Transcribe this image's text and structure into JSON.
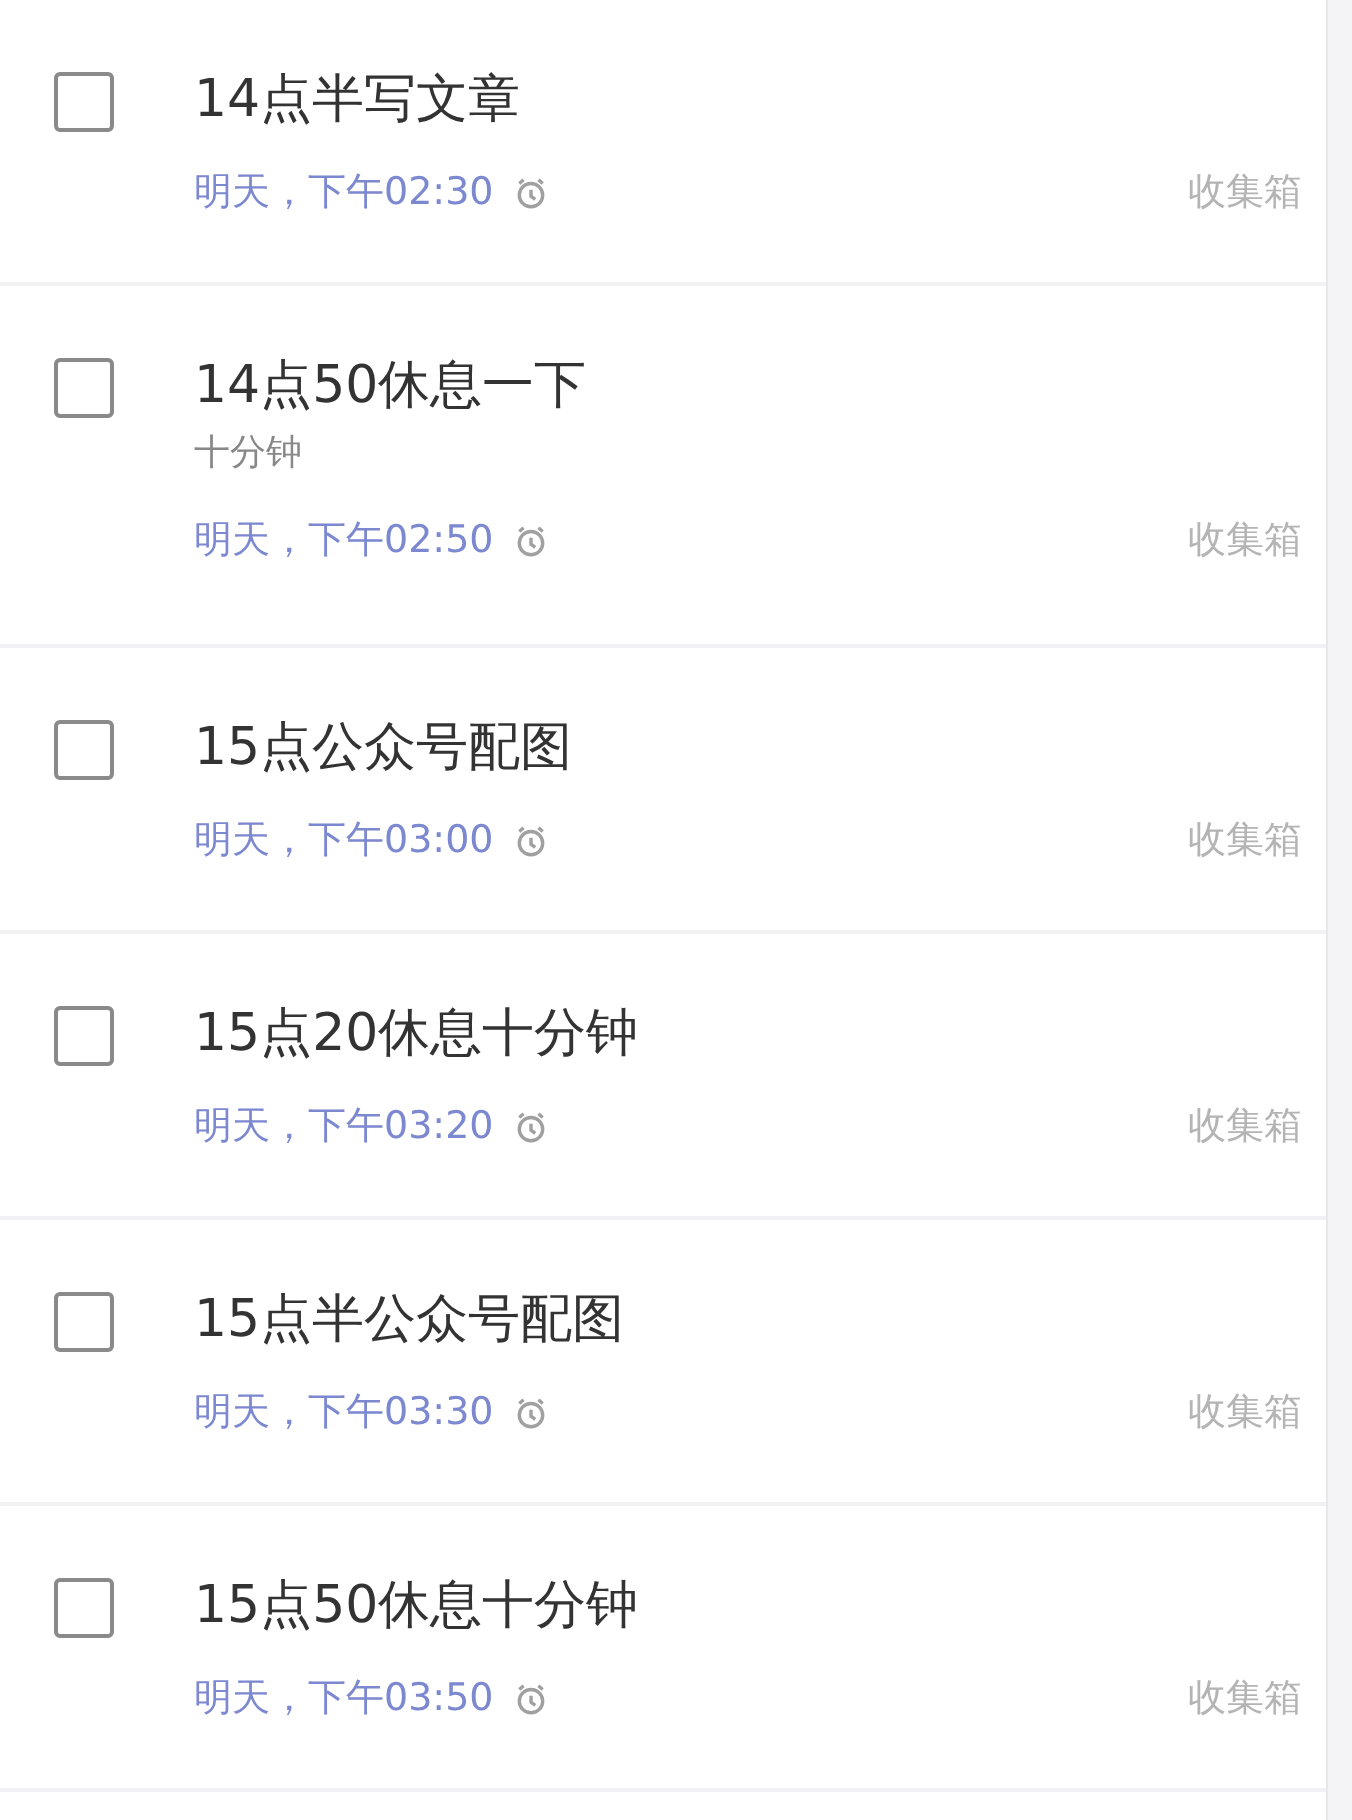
{
  "tasks": [
    {
      "title": "14点半写文章",
      "checked": false,
      "due": "明天，下午02:30",
      "reminder": true,
      "list": "收集箱"
    },
    {
      "title": "14点50休息一下",
      "note": "十分钟",
      "checked": false,
      "due": "明天，下午02:50",
      "reminder": true,
      "list": "收集箱"
    },
    {
      "title": "15点公众号配图",
      "checked": false,
      "due": "明天，下午03:00",
      "reminder": true,
      "list": "收集箱"
    },
    {
      "title": "15点20休息十分钟",
      "checked": false,
      "due": "明天，下午03:20",
      "reminder": true,
      "list": "收集箱"
    },
    {
      "title": "15点半公众号配图",
      "checked": false,
      "due": "明天，下午03:30",
      "reminder": true,
      "list": "收集箱"
    },
    {
      "title": "15点50休息十分钟",
      "checked": false,
      "due": "明天，下午03:50",
      "reminder": true,
      "list": "收集箱"
    }
  ]
}
